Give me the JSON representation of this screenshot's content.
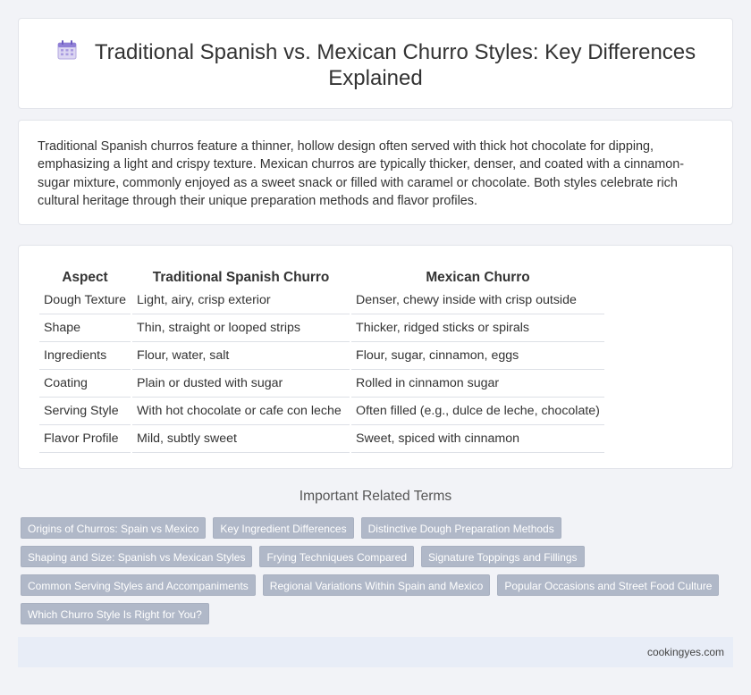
{
  "header": {
    "icon": "calendar-icon",
    "title": "Traditional Spanish vs. Mexican Churro Styles: Key Differences Explained"
  },
  "intro": {
    "text": "Traditional Spanish churros feature a thinner, hollow design often served with thick hot chocolate for dipping, emphasizing a light and crispy texture. Mexican churros are typically thicker, denser, and coated with a cinnamon-sugar mixture, commonly enjoyed as a sweet snack or filled with caramel or chocolate. Both styles celebrate rich cultural heritage through their unique preparation methods and flavor profiles."
  },
  "table": {
    "headers": [
      "Aspect",
      "Traditional Spanish Churro",
      "Mexican Churro"
    ],
    "rows": [
      [
        "Dough Texture",
        "Light, airy, crisp exterior",
        "Denser, chewy inside with crisp outside"
      ],
      [
        "Shape",
        "Thin, straight or looped strips",
        "Thicker, ridged sticks or spirals"
      ],
      [
        "Ingredients",
        "Flour, water, salt",
        "Flour, sugar, cinnamon, eggs"
      ],
      [
        "Coating",
        "Plain or dusted with sugar",
        "Rolled in cinnamon sugar"
      ],
      [
        "Serving Style",
        "With hot chocolate or cafe con leche",
        "Often filled (e.g., dulce de leche, chocolate)"
      ],
      [
        "Flavor Profile",
        "Mild, subtly sweet",
        "Sweet, spiced with cinnamon"
      ]
    ]
  },
  "related": {
    "title": "Important Related Terms",
    "tags": [
      [
        "Origins of Churros: Spain vs Mexico",
        "Key Ingredient Differences",
        "Distinctive Dough Preparation Methods"
      ],
      [
        "Shaping and Size: Spanish vs Mexican Styles",
        "Frying Techniques Compared",
        "Signature Toppings and Fillings"
      ],
      [
        "Common Serving Styles and Accompaniments",
        "Regional Variations Within Spain and Mexico",
        "Popular Occasions and Street Food Culture"
      ],
      [
        "Which Churro Style Is Right for You?"
      ]
    ]
  },
  "footer": {
    "source": "cookingyes.com"
  },
  "colors": {
    "background": "#f2f3f7",
    "tag": "#b0b8c8",
    "footer": "#e8edf7"
  }
}
